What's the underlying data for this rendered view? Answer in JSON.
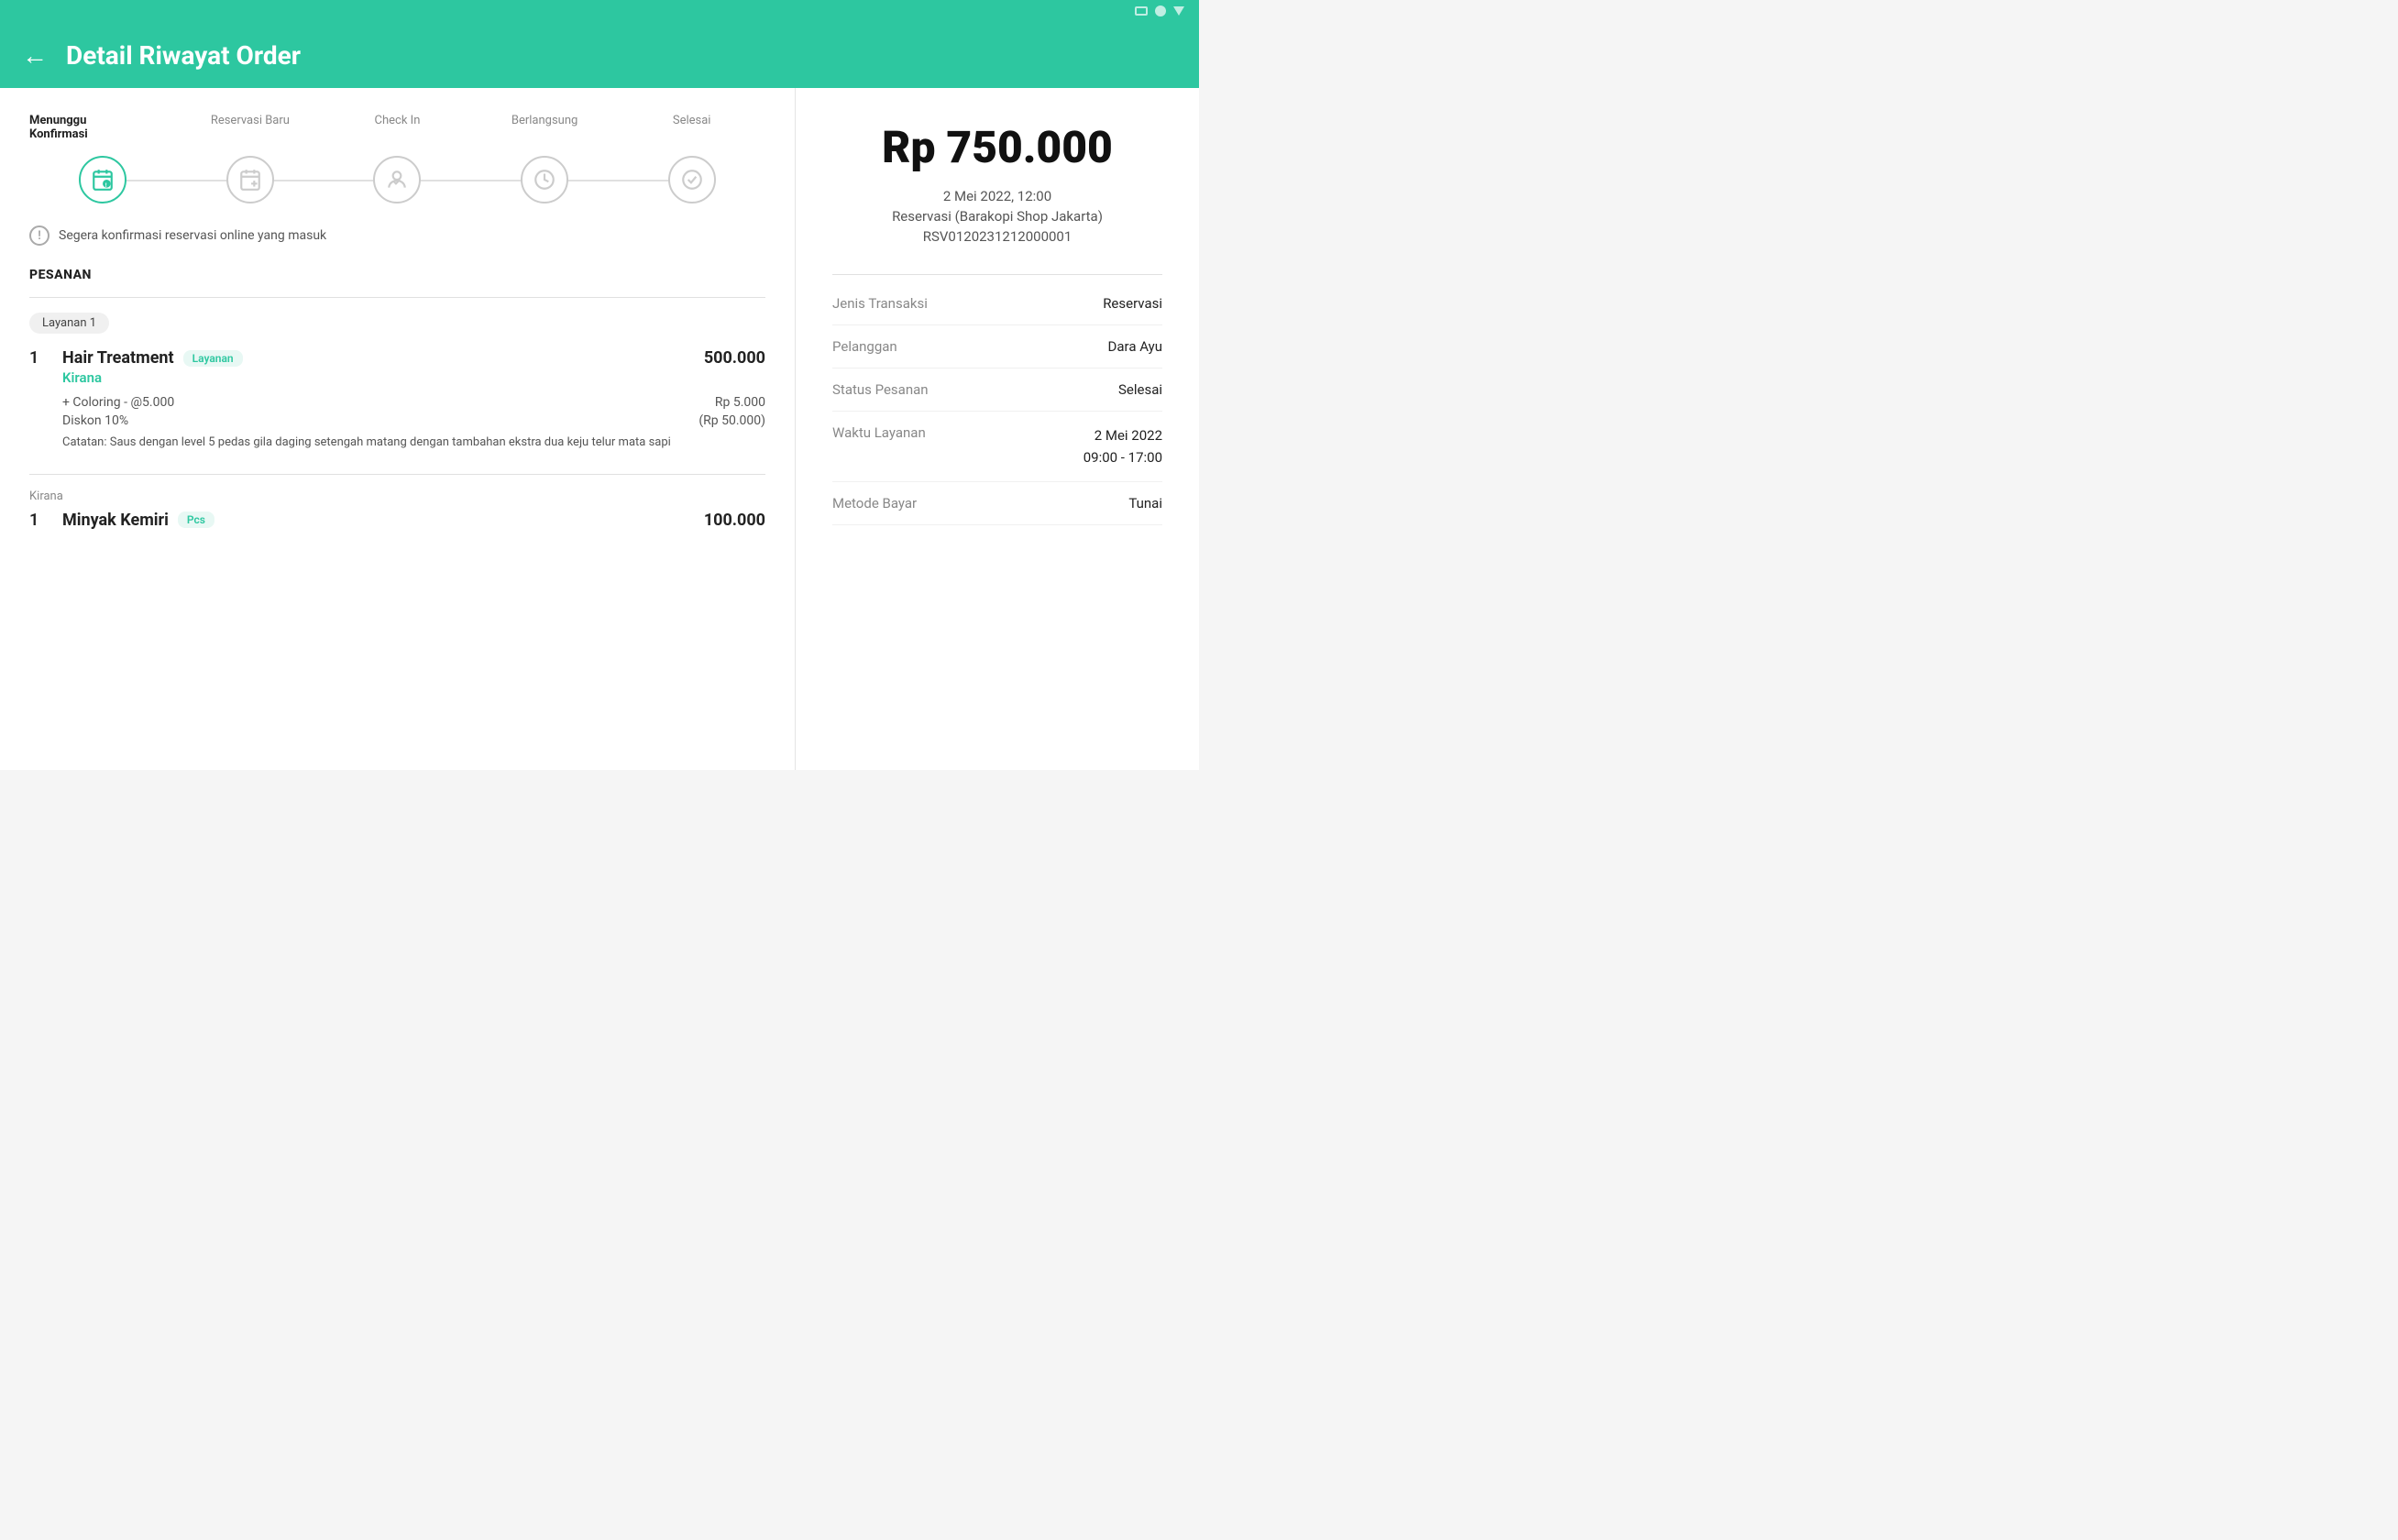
{
  "statusBar": {
    "icons": [
      "rect",
      "circle",
      "triangle"
    ]
  },
  "header": {
    "back_label": "←",
    "title": "Detail Riwayat Order"
  },
  "progressSteps": {
    "steps": [
      {
        "label": "Menunggu\nKonfirmasi",
        "active": true,
        "icon": "📅"
      },
      {
        "label": "Reservasi Baru",
        "active": false,
        "icon": "📅"
      },
      {
        "label": "Check In",
        "active": false,
        "icon": "👤"
      },
      {
        "label": "Berlangsung",
        "active": false,
        "icon": "🕐"
      },
      {
        "label": "Selesai",
        "active": false,
        "icon": "✓"
      }
    ]
  },
  "alertMessage": "Segera konfirmasi reservasi online yang masuk",
  "pesanan": {
    "sectionTitle": "PESANAN",
    "serviceGroup": "Layanan 1",
    "items": [
      {
        "qty": "1",
        "name": "Hair Treatment",
        "tag": "Layanan",
        "staff": "Kirana",
        "price": "500.000",
        "addons": [
          {
            "name": "+ Coloring - @5.000",
            "price": "Rp 5.000"
          }
        ],
        "discounts": [
          {
            "name": "Diskon 10%",
            "price": "(Rp 50.000)"
          }
        ],
        "notes": "Catatan: Saus dengan level 5 pedas gila daging setengah matang dengan tambahan ekstra dua keju telur mata sapi"
      }
    ],
    "secondItem": {
      "staff": "Kirana",
      "qty": "1",
      "name": "Minyak Kemiri",
      "tag": "Pcs",
      "price": "100.000"
    }
  },
  "rightPanel": {
    "totalAmount": "Rp 750.000",
    "date": "2 Mei 2022, 12:00",
    "shop": "Reservasi (Barakopi Shop Jakarta)",
    "orderId": "RSV0120231212000001",
    "infoRows": [
      {
        "label": "Jenis Transaksi",
        "value": "Reservasi"
      },
      {
        "label": "Pelanggan",
        "value": "Dara Ayu"
      },
      {
        "label": "Status Pesanan",
        "value": "Selesai"
      },
      {
        "label": "Waktu Layanan",
        "value": "2 Mei 2022\n09:00 - 17:00"
      },
      {
        "label": "Metode Bayar",
        "value": "Tunai"
      }
    ]
  }
}
